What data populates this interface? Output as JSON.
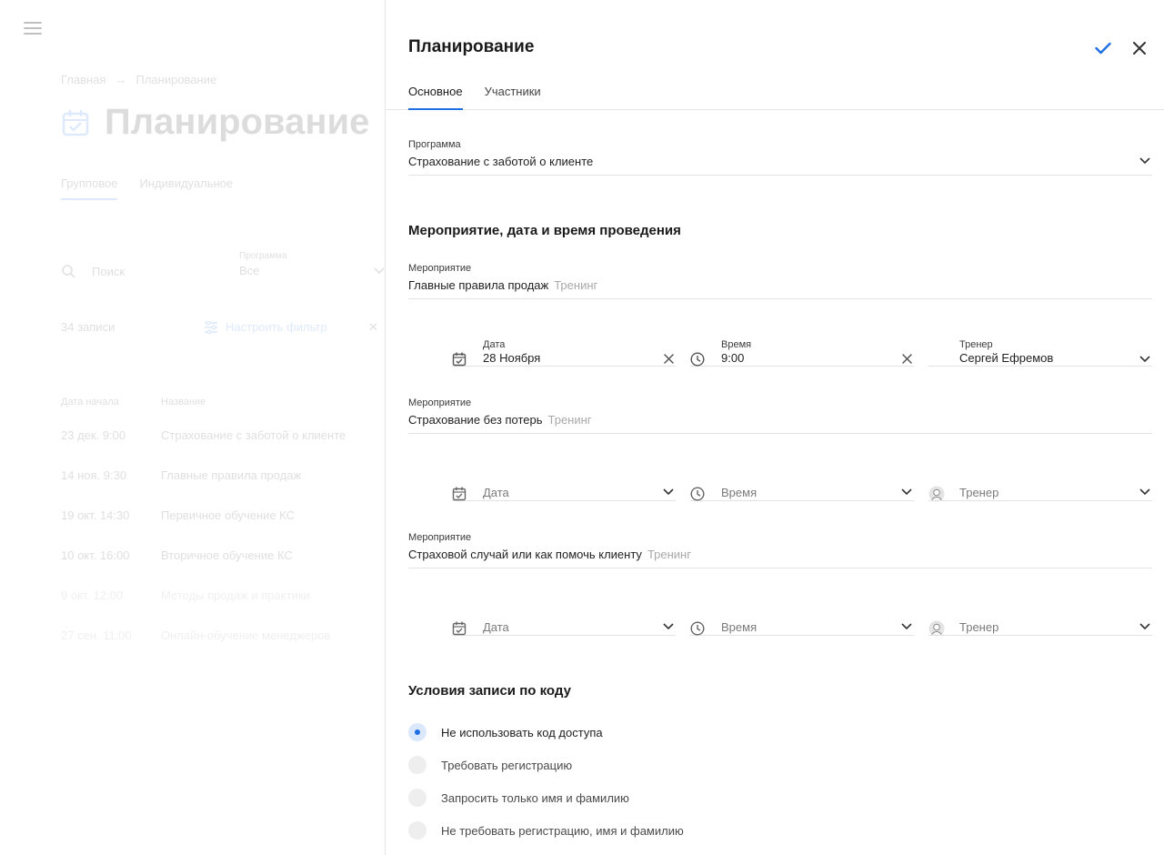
{
  "background": {
    "breadcrumb": [
      "Главная",
      "→",
      "Планирование"
    ],
    "title": "Планирование",
    "tabs": [
      "Групповое",
      "Индивидуальное"
    ],
    "search_placeholder": "Поиск",
    "program_label": "Программа",
    "program_value": "Все",
    "count_text": "34 записи",
    "filter_label": "Настроить фильтр",
    "table": {
      "headers": [
        "Дата начала",
        "Название"
      ],
      "rows": [
        [
          "23 дек. 9:00",
          "Страхование с заботой о клиенте"
        ],
        [
          "14 ноя. 9:30",
          "Главные правила продаж"
        ],
        [
          "19 окт. 14:30",
          "Первичное обучение КС"
        ],
        [
          "10 окт. 16:00",
          "Вторичное обучение КС"
        ],
        [
          "9 окт. 12:00",
          "Методы продаж и практики"
        ],
        [
          "27 сен. 11:00",
          "Онлайн-обучение менеджеров"
        ]
      ]
    }
  },
  "drawer": {
    "title": "Планирование",
    "tabs": [
      "Основное",
      "Участники"
    ],
    "program": {
      "label": "Программа",
      "value": "Страхование с заботой о клиенте"
    },
    "section_event": "Мероприятие, дата и время проведения",
    "events": [
      {
        "label": "Мероприятие",
        "name": "Главные правила продаж",
        "type": "Тренинг",
        "date_label": "Дата",
        "date_value": "28 Ноября",
        "time_label": "Время",
        "time_value": "9:00",
        "trainer_label": "Тренер",
        "trainer_value": "Сергей Ефремов"
      },
      {
        "label": "Мероприятие",
        "name": "Страхование без потерь",
        "type": "Тренинг",
        "date_placeholder": "Дата",
        "time_placeholder": "Время",
        "trainer_placeholder": "Тренер"
      },
      {
        "label": "Мероприятие",
        "name": "Страховой случай или как помочь клиенту",
        "type": "Тренинг",
        "date_placeholder": "Дата",
        "time_placeholder": "Время",
        "trainer_placeholder": "Тренер"
      }
    ],
    "section_code": "Условия записи по коду",
    "radio_options": [
      "Не использовать код доступа",
      "Требовать регистрацию",
      "Запросить только имя и фамилию",
      "Не требовать регистрацию, имя и фамилию"
    ],
    "radio_selected_index": 0
  },
  "colors": {
    "accent": "#1f6fe5",
    "divider": "#e3e3e3",
    "placeholder": "#7a7a7a",
    "tag": "#a8a8a8"
  },
  "icons": [
    "menu-icon",
    "calendar-icon",
    "search-icon",
    "filter-icon",
    "check-icon",
    "close-icon",
    "chevron-down-icon",
    "clock-icon",
    "clear-icon",
    "avatar-icon"
  ]
}
